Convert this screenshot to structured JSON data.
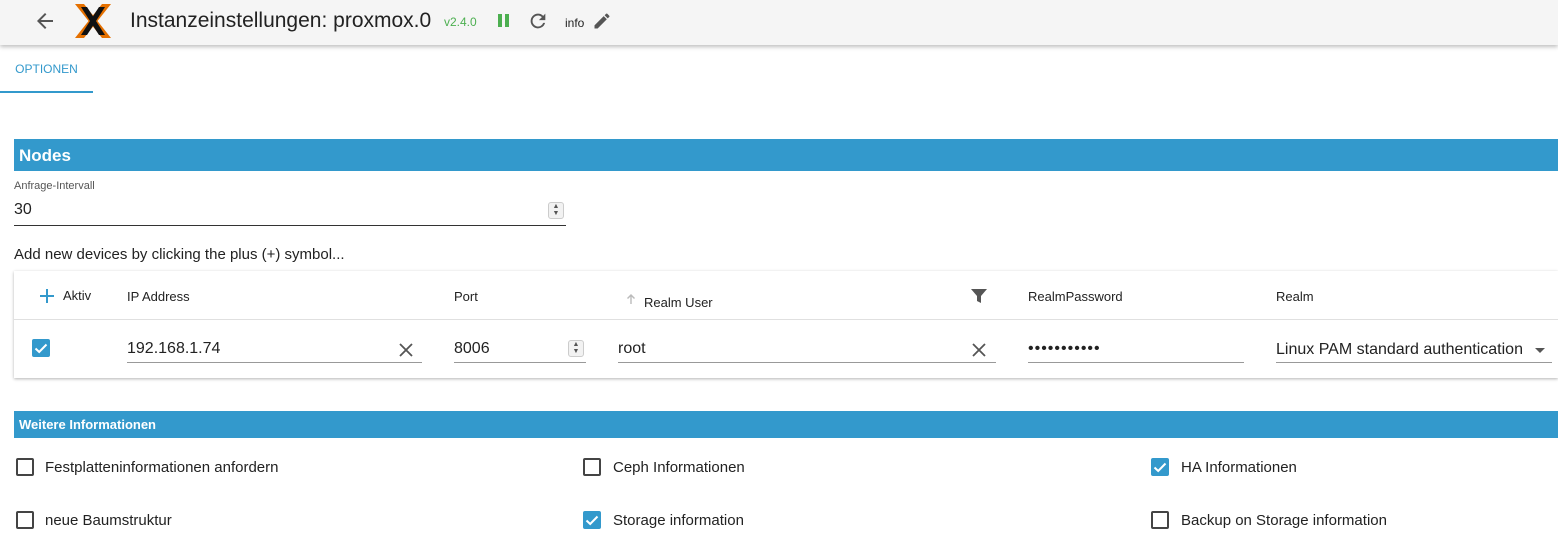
{
  "header": {
    "title": "Instanzeinstellungen: proxmox.0",
    "version": "v2.4.0",
    "log_level": "info"
  },
  "tabs": [
    {
      "label": "OPTIONEN",
      "active": true
    }
  ],
  "nodes_section": {
    "title": "Nodes",
    "interval": {
      "label": "Anfrage-Intervall",
      "value": "30"
    },
    "hint": "Add new devices by clicking the plus (+) symbol...",
    "table": {
      "columns": [
        "Aktiv",
        "IP Address",
        "Port",
        "Realm User",
        "RealmPassword",
        "Realm"
      ],
      "rows": [
        {
          "active": true,
          "ip": "192.168.1.74",
          "port": "8006",
          "realm_user": "root",
          "realm_password": "secretpwd12",
          "realm": "Linux PAM standard authentication"
        }
      ]
    }
  },
  "more_section": {
    "title": "Weitere Informationen",
    "options": [
      {
        "label": "Festplatteninformationen anfordern",
        "checked": false
      },
      {
        "label": "Ceph Informationen",
        "checked": false
      },
      {
        "label": "HA Informationen",
        "checked": true
      },
      {
        "label": "neue Baumstruktur",
        "checked": false
      },
      {
        "label": "Storage information",
        "checked": true
      },
      {
        "label": "Backup on Storage information",
        "checked": false
      }
    ]
  },
  "colors": {
    "accent": "#3399cc",
    "running": "#4caf50"
  },
  "icons": [
    "back-arrow-icon",
    "proxmox-logo-icon",
    "pause-icon",
    "reload-icon",
    "edit-icon",
    "plus-icon",
    "sort-arrow-icon",
    "filter-icon",
    "clear-icon",
    "dropdown-arrow-icon",
    "checkbox-icon"
  ]
}
